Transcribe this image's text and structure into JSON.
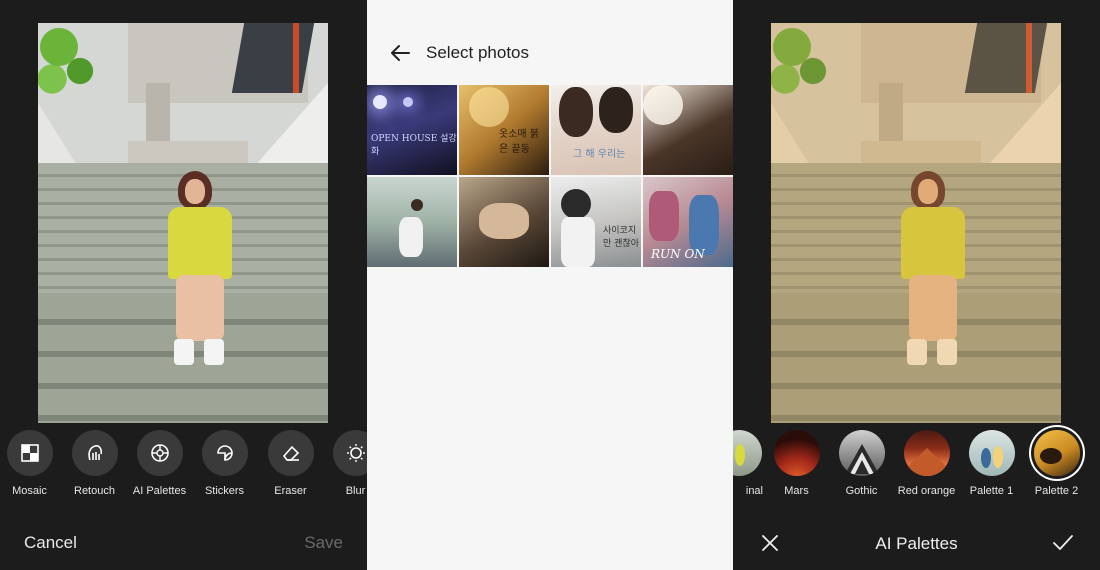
{
  "left_panel": {
    "tools": [
      {
        "label": "Mosaic",
        "icon": "mosaic-icon"
      },
      {
        "label": "Retouch",
        "icon": "retouch-icon"
      },
      {
        "label": "AI Palettes",
        "icon": "palette-icon"
      },
      {
        "label": "Stickers",
        "icon": "sticker-icon"
      },
      {
        "label": "Eraser",
        "icon": "eraser-icon"
      },
      {
        "label": "Blur",
        "icon": "blur-icon"
      }
    ],
    "cancel_label": "Cancel",
    "save_label": "Save"
  },
  "middle_panel": {
    "title": "Select photos",
    "thumbnails": [
      {
        "text": "OPEN HOUSE 설강화"
      },
      {
        "text": "옷소매 붉은 끝동"
      },
      {
        "text": "그 해 우리는"
      },
      {
        "text": ""
      },
      {
        "text": ""
      },
      {
        "text": ""
      },
      {
        "text": "사이코지만 괜찮아"
      },
      {
        "text": "RUN ON"
      }
    ]
  },
  "right_panel": {
    "palettes": [
      {
        "label": "inal"
      },
      {
        "label": "Mars"
      },
      {
        "label": "Gothic"
      },
      {
        "label": "Red orange"
      },
      {
        "label": "Palette 1"
      },
      {
        "label": "Palette 2",
        "selected": true
      }
    ],
    "title": "AI Palettes"
  },
  "colors": {
    "dark_bg": "#1c1c1c",
    "light_bg": "#f6f6f6",
    "tool_circle": "#3a3a3a",
    "disabled_text": "#6a6a6a"
  }
}
